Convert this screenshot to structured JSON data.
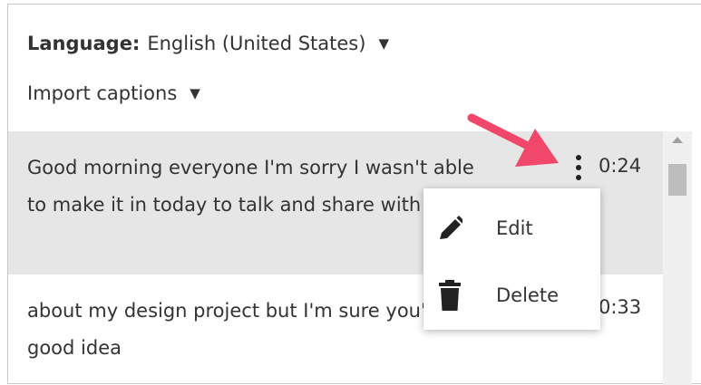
{
  "language": {
    "label": "Language:",
    "value": "English (United States)",
    "caret": "▼"
  },
  "import": {
    "label": "Import captions",
    "caret": "▼"
  },
  "captions": [
    {
      "text": "Good morning everyone I'm sorry I wasn't able to make it in today to talk and share with you",
      "time": "0:24"
    },
    {
      "text": "about my design project but I'm sure you'll get a good idea",
      "time": "0:33"
    }
  ],
  "context_menu": {
    "items": [
      {
        "label": "Edit",
        "icon": "pencil-icon"
      },
      {
        "label": "Delete",
        "icon": "trash-icon"
      }
    ]
  },
  "colors": {
    "selected_row_bg": "#e6e6e6",
    "annotation_arrow": "#f0476a",
    "text": "#333333"
  }
}
